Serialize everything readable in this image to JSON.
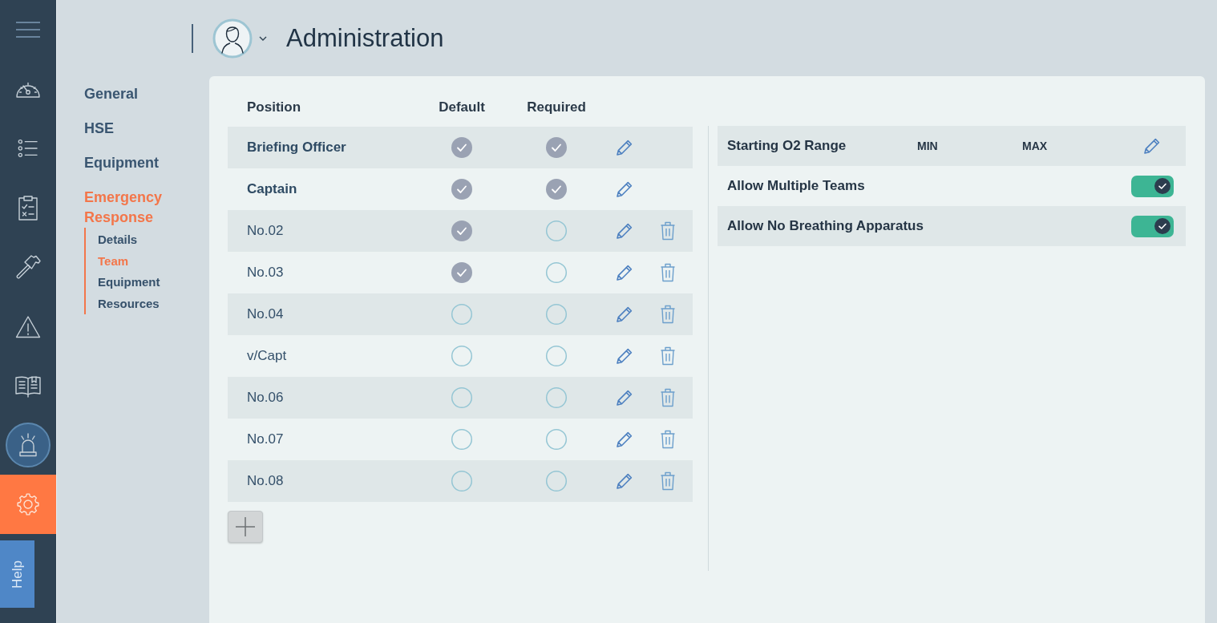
{
  "rail": {
    "items": [
      {
        "kind": "menu",
        "selected": false
      },
      {
        "kind": "dashboard",
        "selected": false
      },
      {
        "kind": "checklist",
        "selected": false
      },
      {
        "kind": "clipboard",
        "selected": false
      },
      {
        "kind": "tools",
        "selected": false
      },
      {
        "kind": "warning",
        "selected": false
      },
      {
        "kind": "manual",
        "selected": false
      },
      {
        "kind": "alarm",
        "selected": false
      },
      {
        "kind": "settings",
        "selected": true
      }
    ],
    "help_label": "Help"
  },
  "header": {
    "title": "Administration"
  },
  "nav": {
    "items": [
      {
        "label": "General",
        "selected": false
      },
      {
        "label": "HSE",
        "selected": false
      },
      {
        "label": "Equipment",
        "selected": false
      },
      {
        "label": "Emergency Response",
        "selected": true,
        "children": [
          {
            "label": "Details",
            "selected": false
          },
          {
            "label": "Team",
            "selected": true
          },
          {
            "label": "Equipment",
            "selected": false
          },
          {
            "label": "Resources",
            "selected": false
          }
        ]
      }
    ]
  },
  "team": {
    "columns": [
      "Position",
      "Default",
      "Required"
    ],
    "rows": [
      {
        "position": "Briefing Officer",
        "kind": "fixed",
        "default": true,
        "required": true
      },
      {
        "position": "Captain",
        "kind": "fixed",
        "default": true,
        "required": true
      },
      {
        "position": "No.02",
        "kind": "custom",
        "default": true,
        "required": false
      },
      {
        "position": "No.03",
        "kind": "custom",
        "default": true,
        "required": false
      },
      {
        "position": "No.04",
        "kind": "custom",
        "default": false,
        "required": false
      },
      {
        "position": "v/Capt",
        "kind": "custom",
        "default": false,
        "required": false
      },
      {
        "position": "No.06",
        "kind": "custom",
        "default": false,
        "required": false
      },
      {
        "position": "No.07",
        "kind": "custom",
        "default": false,
        "required": false
      },
      {
        "position": "No.08",
        "kind": "custom",
        "default": false,
        "required": false
      }
    ]
  },
  "settings": {
    "rows": [
      {
        "kind": "range",
        "label": "Starting O2 Range",
        "min_label": "MIN",
        "max_label": "MAX"
      },
      {
        "kind": "toggle",
        "label": "Allow Multiple Teams",
        "on": true
      },
      {
        "kind": "toggle",
        "label": "Allow No Breathing Apparatus",
        "on": true
      }
    ]
  }
}
